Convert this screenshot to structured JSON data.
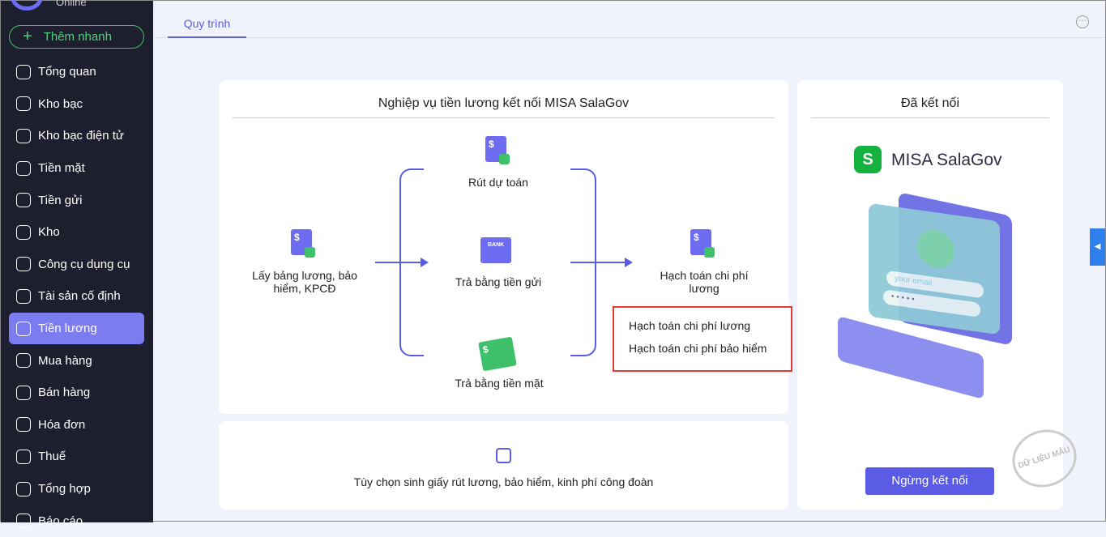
{
  "app": {
    "logo_text": "Online",
    "quick_add": "Thêm nhanh"
  },
  "sidebar": {
    "items": [
      {
        "label": "Tổng quan",
        "icon": "pie-chart-icon"
      },
      {
        "label": "Kho bạc",
        "icon": "treasury-icon"
      },
      {
        "label": "Kho bạc điện tử",
        "icon": "e-treasury-icon"
      },
      {
        "label": "Tiền mặt",
        "icon": "cash-icon"
      },
      {
        "label": "Tiền gửi",
        "icon": "deposit-icon"
      },
      {
        "label": "Kho",
        "icon": "warehouse-icon"
      },
      {
        "label": "Công cụ dụng cụ",
        "icon": "tools-icon"
      },
      {
        "label": "Tài sản cố định",
        "icon": "truck-icon"
      },
      {
        "label": "Tiền lương",
        "icon": "salary-icon",
        "active": true
      },
      {
        "label": "Mua hàng",
        "icon": "cart-icon"
      },
      {
        "label": "Bán hàng",
        "icon": "store-icon"
      },
      {
        "label": "Hóa đơn",
        "icon": "invoice-icon"
      },
      {
        "label": "Thuế",
        "icon": "tax-icon"
      },
      {
        "label": "Tổng hợp",
        "icon": "summary-icon"
      },
      {
        "label": "Báo cáo",
        "icon": "report-icon"
      }
    ]
  },
  "tabs": {
    "active": "Quy trình"
  },
  "process": {
    "title": "Nghiệp vụ tiền lương kết nối MISA SalaGov",
    "step1": "Lấy bảng lương, bảo hiểm, KPCĐ",
    "withdraw": "Rút dự toán",
    "bank": "Trả bằng tiền gửi",
    "bank_icon_text": "BANK",
    "cash": "Trả bằng tiền mặt",
    "account": "Hạch toán chi phí lương"
  },
  "popup": {
    "items": [
      "Hạch toán chi phí lương",
      "Hạch toán chi phí bảo hiểm"
    ]
  },
  "options": {
    "label": "Tùy chọn sinh giấy rút lương, bảo hiểm, kinh phí công đoàn"
  },
  "connection": {
    "title": "Đã kết nối",
    "brand": "MISA SalaGov",
    "email_placeholder": "your email",
    "stop_button": "Ngừng kết nối",
    "watermark": "DỮ LIỆU MẪU"
  },
  "colors": {
    "accent": "#5b5ce6",
    "sidebar": "#1e1f2e",
    "green": "#3fc06a",
    "highlight": "#e53935"
  }
}
